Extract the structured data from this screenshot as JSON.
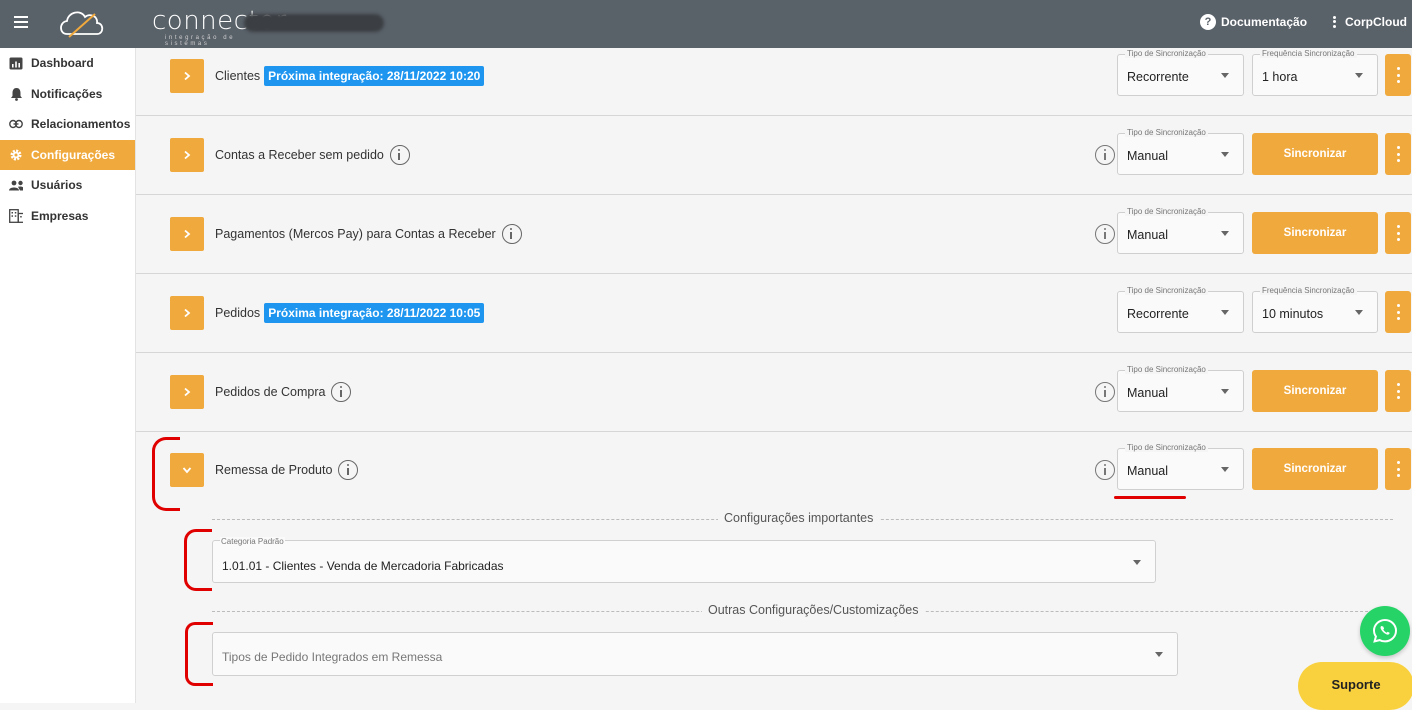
{
  "app": {
    "logo_text": "connector",
    "logo_subtitle": "integração de sistemas",
    "doc_label": "Documentação",
    "account_label": "CorpCloud"
  },
  "sidebar": {
    "items": [
      {
        "label": "Dashboard",
        "icon": "dashboard-icon",
        "active": false
      },
      {
        "label": "Notificações",
        "icon": "bell-icon",
        "active": false
      },
      {
        "label": "Relacionamentos",
        "icon": "link-icon",
        "active": false
      },
      {
        "label": "Configurações",
        "icon": "gear-icon",
        "active": true
      },
      {
        "label": "Usuários",
        "icon": "users-icon",
        "active": false
      },
      {
        "label": "Empresas",
        "icon": "building-icon",
        "active": false
      }
    ]
  },
  "common": {
    "sync_type_label": "Tipo de Sincronização",
    "sync_freq_label": "Frequência Sincronização",
    "sync_button": "Sincronizar"
  },
  "rows": [
    {
      "label": "Clientes",
      "badge": "Próxima integração: 28/11/2022 10:20",
      "sync_type": "Recorrente",
      "frequency": "1 hora"
    },
    {
      "label": "Contas a Receber sem pedido",
      "sync_type": "Manual"
    },
    {
      "label": "Pagamentos (Mercos Pay) para Contas a Receber",
      "sync_type": "Manual"
    },
    {
      "label": "Pedidos",
      "badge": "Próxima integração: 28/11/2022 10:05",
      "sync_type": "Recorrente",
      "frequency": "10 minutos"
    },
    {
      "label": "Pedidos de Compra",
      "sync_type": "Manual"
    },
    {
      "label": "Remessa de Produto",
      "sync_type": "Manual",
      "expanded": true
    }
  ],
  "expanded": {
    "section1_title": "Configurações importantes",
    "category_label": "Categoria Padrão",
    "category_value": "1.01.01 - Clientes - Venda de Mercadoria Fabricadas",
    "section2_title": "Outras Configurações/Customizações",
    "order_types_placeholder": "Tipos de Pedido Integrados em Remessa"
  },
  "support": {
    "label": "Suporte"
  },
  "colors": {
    "accent": "#f0a93d",
    "topbar": "#596169",
    "badge": "#1e96f0",
    "annotation": "#e00000"
  }
}
